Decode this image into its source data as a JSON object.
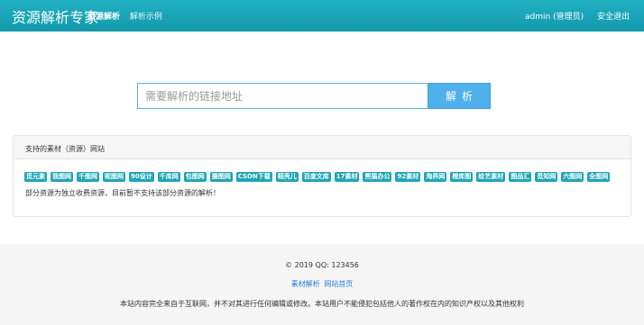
{
  "navbar": {
    "brand": "资源解析专家",
    "links": [
      {
        "label": "资源解析",
        "active": true
      },
      {
        "label": "解析示例",
        "active": false
      }
    ],
    "user": "admin (管理员)",
    "logout": "安全退出",
    "color": "#17a2b8"
  },
  "search": {
    "placeholder": "需要解析的链接地址",
    "value": "",
    "button_label": "解析",
    "button_color": "#4fb0ec"
  },
  "panel": {
    "title": "支持的素材（资源）网站",
    "sites": [
      "觅元素",
      "我图网",
      "千图网",
      "昵图网",
      "90设计",
      "千库网",
      "包图网",
      "摄图网",
      "CSDN下载",
      "稻壳儿",
      "百度文库",
      "17素材",
      "熊猫办公",
      "92素材",
      "淘界网",
      "橙库图",
      "绘艺素材",
      "图品汇",
      "觅知网",
      "六图网",
      "全图网"
    ],
    "note": "部分资源为独立收费资源，目前暂不支持该部分资源的解析！",
    "badge_color": "#1ea5b6"
  },
  "footer": {
    "copyright": "© 2019 QQ:  123456",
    "links": [
      "素材解析",
      "网站首页"
    ],
    "disclaimer": "本站内容完全来自于互联网，并不对其进行任何编辑或修改。本站用户不能侵犯包括他人的著作权在内的知识产权以及其他权利"
  }
}
